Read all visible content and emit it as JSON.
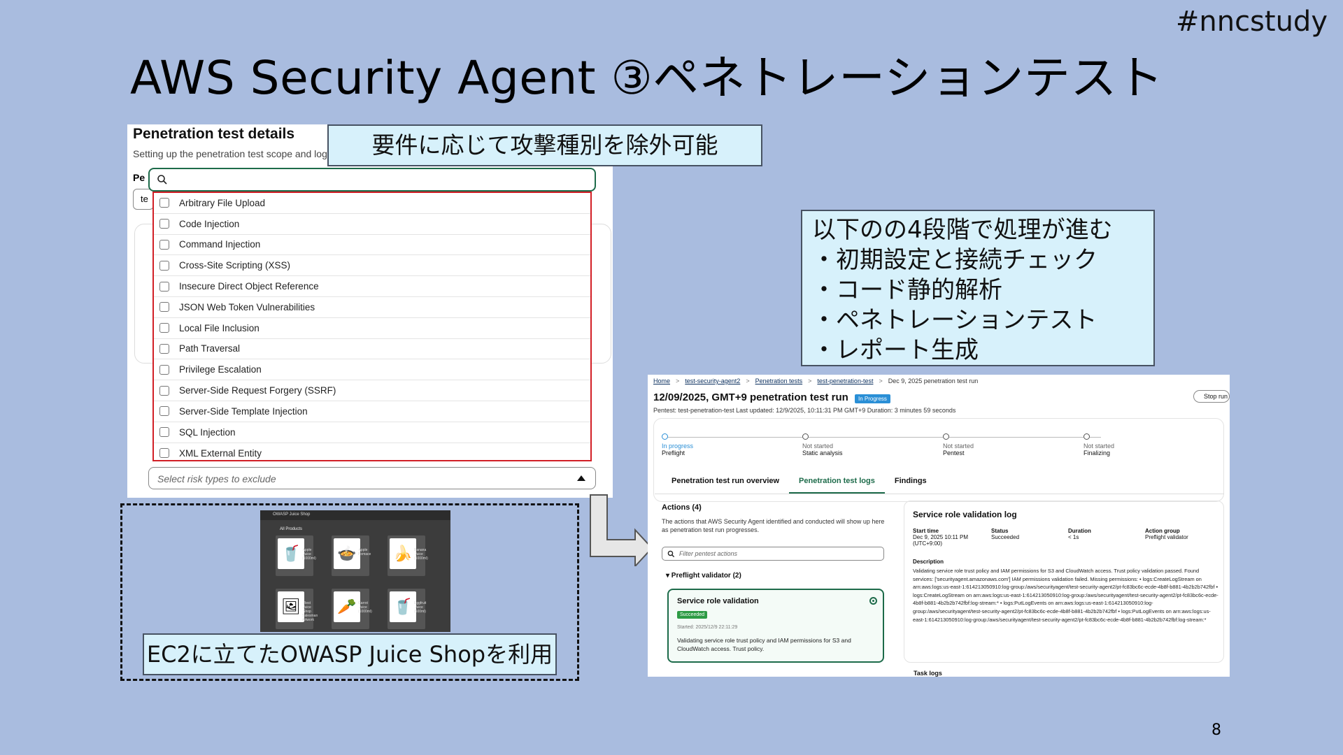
{
  "hashtag": "#nncstudy",
  "title": "AWS Security Agent ③ペネトレーションテスト",
  "page_number": "8",
  "pentest_panel": {
    "title": "Penetration test details",
    "subtitle": "Setting up the penetration test scope and log",
    "field_label_partial": "Pe",
    "field_value_partial": "te",
    "options": [
      "Arbitrary File Upload",
      "Code Injection",
      "Command Injection",
      "Cross-Site Scripting (XSS)",
      "Insecure Direct Object Reference",
      "JSON Web Token Vulnerabilities",
      "Local File Inclusion",
      "Path Traversal",
      "Privilege Escalation",
      "Server-Side Request Forgery (SSRF)",
      "Server-Side Template Injection",
      "SQL Injection",
      "XML External Entity"
    ],
    "select_placeholder": "Select risk types to exclude"
  },
  "callout_exclude": "要件に応じて攻撃種別を除外可能",
  "callout_stages": {
    "heading": "以下のの4段階で処理が進む",
    "items": [
      "・初期設定と接続チェック",
      "・コード静的解析",
      "・ペネトレーションテスト",
      "・レポート生成"
    ]
  },
  "juice_shop": {
    "app_title": "OWASP Juice Shop",
    "section": "All Products",
    "products": [
      "Apple Juice (1000ml)",
      "Apple Pomace",
      "Banana Juice (1000ml)",
      "Best Juice Shop Salesman Artwork",
      "Carrot Juice (1000ml)",
      "Eggfruit Juice (500ml)"
    ],
    "callout": "EC2に立てたOWASP Juice Shopを利用"
  },
  "run": {
    "breadcrumb": [
      "Home",
      "test-security-agent2",
      "Penetration tests",
      "test-penetration-test",
      "Dec 9, 2025 penetration test run"
    ],
    "title": "12/09/2025, GMT+9 penetration test run",
    "status_badge": "In Progress",
    "stop_label": "Stop run",
    "meta": "Pentest: test-penetration-test    Last updated: 12/9/2025, 10:11:31 PM GMT+9    Duration: 3 minutes 59 seconds",
    "stages": [
      {
        "status": "In progress",
        "name": "Preflight"
      },
      {
        "status": "Not started",
        "name": "Static analysis"
      },
      {
        "status": "Not started",
        "name": "Pentest"
      },
      {
        "status": "Not started",
        "name": "Finalizing"
      }
    ],
    "tabs": [
      "Penetration test run overview",
      "Penetration test logs",
      "Findings"
    ],
    "actions_heading": "Actions (4)",
    "actions_desc": "The actions that AWS Security Agent identified and conducted will show up here as penetration test run progresses.",
    "filter_placeholder": "Filter pentest actions",
    "validator_group": "▾ Preflight validator (2)",
    "service_card": {
      "title": "Service role validation",
      "status": "Succeeded",
      "started": "Started: 2025/12/9 22:11:29",
      "desc": "Validating service role trust policy and IAM permissions for S3 and CloudWatch access. Trust policy."
    },
    "log": {
      "title": "Service role validation log",
      "columns": [
        {
          "key": "Start time",
          "value": "Dec 9, 2025 10:11 PM (UTC+9:00)"
        },
        {
          "key": "Status",
          "value": "Succeeded"
        },
        {
          "key": "Duration",
          "value": "< 1s"
        },
        {
          "key": "Action group",
          "value": "Preflight validator"
        }
      ],
      "desc_heading": "Description",
      "desc": "Validating service role trust policy and IAM permissions for S3 and CloudWatch access. Trust policy validation passed. Found services: ['securityagent.amazonaws.com'] IAM permissions validation failed. Missing permissions: • logs:CreateLogStream on arn:aws:logs:us-east-1:614213050910:log-group:/aws/securityagent/test-security-agent2/pt-fc83bc6c-ecde-4b8f-b881-4b2b2b742fbf • logs:CreateLogStream on arn:aws:logs:us-east-1:614213050910:log-group:/aws/securityagent/test-security-agent2/pt-fc83bc6c-ecde-4b8f-b881-4b2b2b742fbf:log-stream:* • logs:PutLogEvents on arn:aws:logs:us-east-1:614213050910:log-group:/aws/securityagent/test-security-agent2/pt-fc83bc6c-ecde-4b8f-b881-4b2b2b742fbf • logs:PutLogEvents on arn:aws:logs:us-east-1:614213050910:log-group:/aws/securityagent/test-security-agent2/pt-fc83bc6c-ecde-4b8f-b881-4b2b2b742fbf:log-stream:*"
    },
    "task_logs": "Task logs"
  }
}
